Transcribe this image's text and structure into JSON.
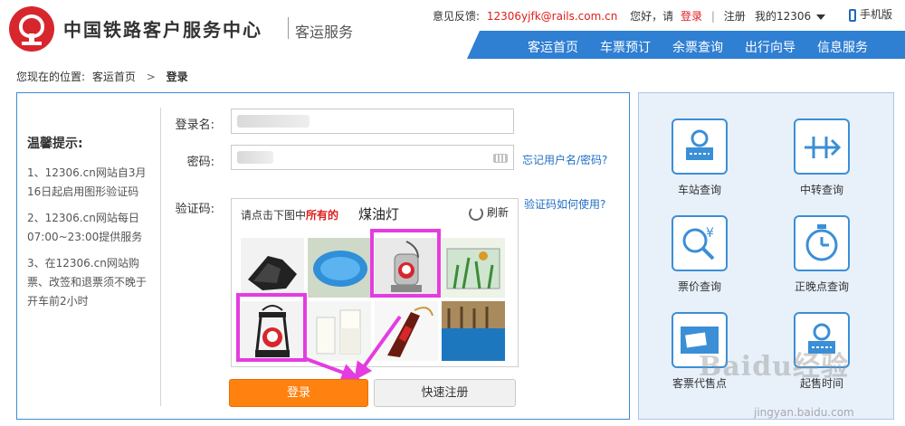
{
  "header": {
    "brand": "中国铁路客户服务中心",
    "brand_sub": "客运服务",
    "feedback_label": "意见反馈:",
    "feedback_email": "12306yjfk@rails.com.cn",
    "greeting": "您好，请",
    "login_link": "登录",
    "divider": "|",
    "register_link": "注册",
    "my12306": "我的12306",
    "mobile": "手机版"
  },
  "nav": {
    "items": [
      "客运首页",
      "车票预订",
      "余票查询",
      "出行向导",
      "信息服务"
    ]
  },
  "breadcrumb": {
    "prefix": "您现在的位置:",
    "home": "客运首页",
    "arrow": ">",
    "current": "登录"
  },
  "tips": {
    "title": "温馨提示:",
    "items": [
      "1、12306.cn网站自3月16日起启用图形验证码",
      "2、12306.cn网站每日07:00~23:00提供服务",
      "3、在12306.cn网站购票、改签和退票须不晚于开车前2小时"
    ]
  },
  "form": {
    "username_label": "登录名:",
    "password_label": "密码:",
    "forgot_link": "忘记用户名/密码?",
    "captcha_label": "验证码:",
    "captcha_help_link": "验证码如何使用?"
  },
  "captcha": {
    "prompt_pre": "请点击下图中",
    "prompt_highlight": "所有的",
    "target": "煤油灯",
    "refresh": "刷新",
    "tiles": [
      "gloves",
      "pool",
      "kerosene-lamp",
      "aquarium",
      "kerosene-lamp",
      "milk",
      "cola",
      "indoor-pool"
    ],
    "selected": [
      2,
      4
    ]
  },
  "buttons": {
    "login": "登录",
    "quick_register": "快速注册"
  },
  "services": [
    {
      "label": "车站查询",
      "icon": "station-icon"
    },
    {
      "label": "中转查询",
      "icon": "transfer-icon"
    },
    {
      "label": "票价查询",
      "icon": "fare-icon"
    },
    {
      "label": "正晚点查询",
      "icon": "clock-icon"
    },
    {
      "label": "客票代售点",
      "icon": "ticket-agent-icon"
    },
    {
      "label": "起售时间",
      "icon": "sale-time-icon"
    }
  ],
  "watermark": {
    "main": "Baidu经验",
    "url": "jingyan.baidu.com"
  },
  "colors": {
    "brand_red": "#d7262d",
    "nav_blue": "#2f7fd3",
    "login_orange": "#ff8110",
    "select_magenta": "#e43ce0"
  }
}
